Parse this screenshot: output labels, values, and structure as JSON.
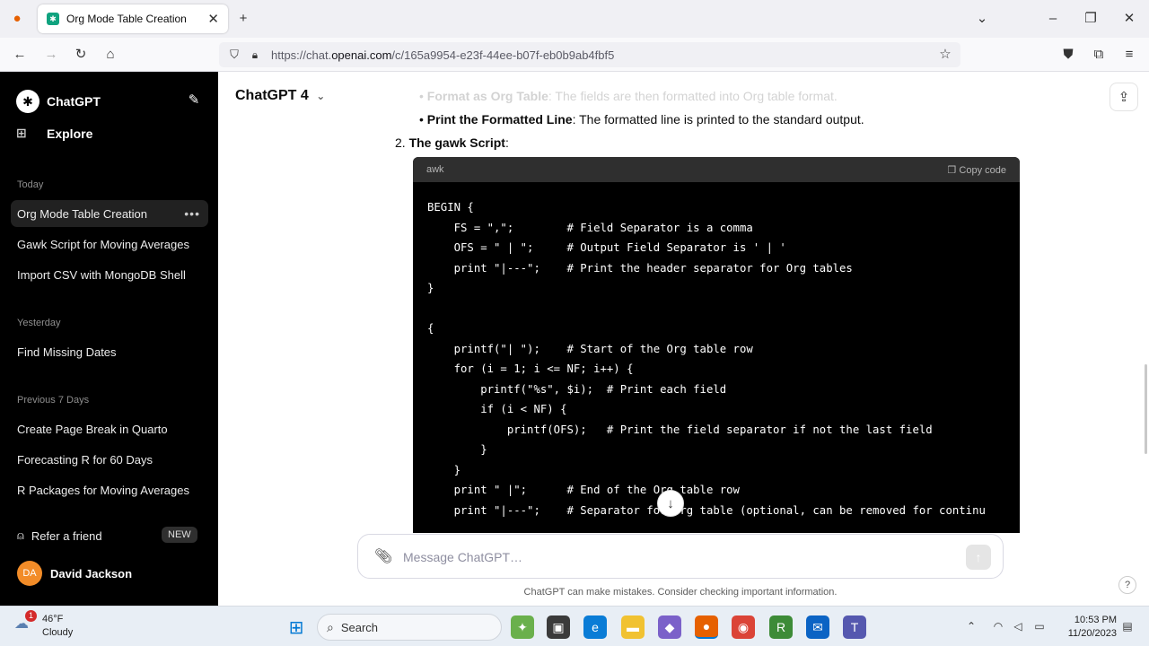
{
  "browser": {
    "tab_title": "Org Mode Table Creation",
    "url_prefix": "https://chat.",
    "url_domain": "openai.com",
    "url_rest": "/c/165a9954-e23f-44ee-b07f-eb0b9ab4fbf5"
  },
  "sidebar": {
    "brand": "ChatGPT",
    "explore": "Explore",
    "sections": [
      {
        "heading": "Today",
        "items": [
          "Org Mode Table Creation",
          "Gawk Script for Moving Averages",
          "Import CSV with MongoDB Shell"
        ]
      },
      {
        "heading": "Yesterday",
        "items": [
          "Find Missing Dates"
        ]
      },
      {
        "heading": "Previous 7 Days",
        "items": [
          "Create Page Break in Quarto",
          "Forecasting R for 60 Days",
          "R Packages for Moving Averages"
        ]
      }
    ],
    "refer": "Refer a friend",
    "new_badge": "NEW",
    "user_initials": "DA",
    "user_name": "David Jackson"
  },
  "main": {
    "model": "ChatGPT 4",
    "bullets": [
      {
        "bold": "Format as Org Table",
        "text": ": The fields are then formatted into Org table format."
      },
      {
        "bold": "Print the Formatted Line",
        "text": ": The formatted line is printed to the standard output."
      }
    ],
    "step2_number": "2.",
    "step2_label": "The gawk Script",
    "step2_colon": ":",
    "code_lang": "awk",
    "copy_label": "Copy code",
    "code": [
      "BEGIN {",
      "    FS = \",\";        # Field Separator is a comma",
      "    OFS = \" | \";     # Output Field Separator is ' | '",
      "    print \"|---\";    # Print the header separator for Org tables",
      "}",
      "",
      "{",
      "    printf(\"| \");    # Start of the Org table row",
      "    for (i = 1; i <= NF; i++) {",
      "        printf(\"%s\", $i);  # Print each field",
      "        if (i < NF) {",
      "            printf(OFS);   # Print the field separator if not the last field",
      "        }",
      "    }",
      "    print \" |\";      # End of the Org table row",
      "    print \"|---\";    # Separator for Org table (optional, can be removed for continu"
    ],
    "composer_placeholder": "Message ChatGPT…",
    "disclaimer": "ChatGPT can make mistakes. Consider checking important information.",
    "help": "?"
  },
  "taskbar": {
    "temp": "46°F",
    "condition": "Cloudy",
    "weather_badge": "1",
    "search": "Search",
    "time": "10:53 PM",
    "date": "11/20/2023"
  }
}
